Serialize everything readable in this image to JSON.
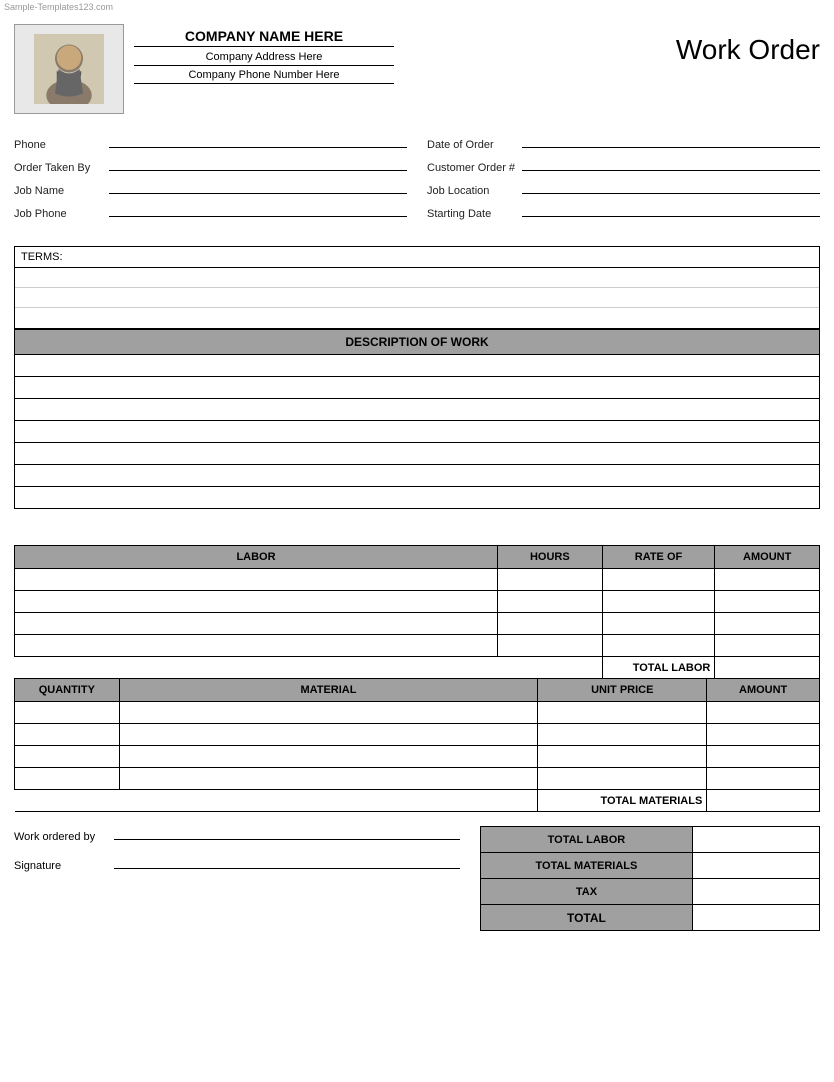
{
  "watermark": "Sample-Templates123.com",
  "header": {
    "company_name": "COMPANY NAME HERE",
    "company_address": "Company Address Here",
    "company_phone": "Company Phone Number Here",
    "title": "Work Order"
  },
  "form": {
    "left": [
      {
        "label": "Phone",
        "value": ""
      },
      {
        "label": "Order Taken By",
        "value": ""
      },
      {
        "label": "Job Name",
        "value": ""
      },
      {
        "label": "Job Phone",
        "value": ""
      }
    ],
    "right": [
      {
        "label": "Date of Order",
        "value": ""
      },
      {
        "label": "Customer Order #",
        "value": ""
      },
      {
        "label": "Job Location",
        "value": ""
      },
      {
        "label": "Starting Date",
        "value": ""
      }
    ]
  },
  "terms": {
    "label": "TERMS:",
    "rows": 3
  },
  "description_of_work": {
    "header": "DESCRIPTION OF WORK",
    "rows": 7
  },
  "labor": {
    "columns": [
      "LABOR",
      "HOURS",
      "RATE OF",
      "AMOUNT"
    ],
    "col_widths": [
      "60%",
      "13%",
      "14%",
      "13%"
    ],
    "rows": 4,
    "total_label": "TOTAL LABOR"
  },
  "materials": {
    "columns": [
      "QUANTITY",
      "MATERIAL",
      "UNIT PRICE",
      "AMOUNT"
    ],
    "col_widths": [
      "13%",
      "52%",
      "21%",
      "14%"
    ],
    "rows": 4,
    "total_label": "TOTAL MATERIALS"
  },
  "summary": {
    "rows": [
      {
        "label": "TOTAL LABOR",
        "value": ""
      },
      {
        "label": "TOTAL MATERIALS",
        "value": ""
      },
      {
        "label": "TAX",
        "value": ""
      },
      {
        "label": "TOTAL",
        "value": ""
      }
    ],
    "work_ordered_by_label": "Work ordered by",
    "signature_label": "Signature"
  }
}
